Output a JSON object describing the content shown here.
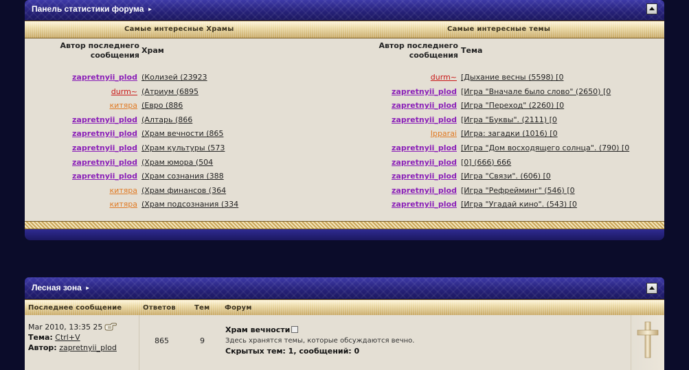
{
  "stats_panel": {
    "title": "Панель статистики форума",
    "left": {
      "heading": "Самые интересные Храмы",
      "col_author": "Автор последнего\nсообщения",
      "col_item": "Храм",
      "rows": [
        {
          "author": "zapretnyii_plod",
          "style": "purple",
          "item": "(Колизей (23923"
        },
        {
          "author": "durm~",
          "style": "red",
          "item": "(Атриум (6895"
        },
        {
          "author": "китяра",
          "style": "orange",
          "item": "(Евро (886"
        },
        {
          "author": "zapretnyii_plod",
          "style": "purple",
          "item": "(Алтарь (866"
        },
        {
          "author": "zapretnyii_plod",
          "style": "purple",
          "item": "(Храм вечности (865"
        },
        {
          "author": "zapretnyii_plod",
          "style": "purple",
          "item": "(Храм культуры (573"
        },
        {
          "author": "zapretnyii_plod",
          "style": "purple",
          "item": "(Храм юмора (504"
        },
        {
          "author": "zapretnyii_plod",
          "style": "purple",
          "item": "(Храм сознания (388"
        },
        {
          "author": "китяра",
          "style": "orange",
          "item": "(Храм финансов (364"
        },
        {
          "author": "китяра",
          "style": "orange",
          "item": "(Храм подсознания (334"
        }
      ]
    },
    "right": {
      "heading": "Самые интересные темы",
      "col_author": "Автор последнего\nсообщения",
      "col_item": "Тема",
      "rows": [
        {
          "author": "durm~",
          "style": "red",
          "item": "[Дыхание весны (5598) [0"
        },
        {
          "author": "zapretnyii_plod",
          "style": "purple",
          "item": "[Игра \"Вначале было слово\" (2650) [0"
        },
        {
          "author": "zapretnyii_plod",
          "style": "purple",
          "item": "[Игра \"Переход\" (2260) [0"
        },
        {
          "author": "zapretnyii_plod",
          "style": "purple",
          "item": "[Игра \"Буквы\". (2111) [0"
        },
        {
          "author": "Ipparai",
          "style": "orange",
          "item": "[Игра: загадки (1016) [0"
        },
        {
          "author": "zapretnyii_plod",
          "style": "purple",
          "item": "[Игра \"Дом восходящего солнца\". (790) [0"
        },
        {
          "author": "zapretnyii_plod",
          "style": "purple",
          "item": "[0] (666) 666"
        },
        {
          "author": "zapretnyii_plod",
          "style": "purple",
          "item": "[Игра \"Связи\". (606) [0"
        },
        {
          "author": "zapretnyii_plod",
          "style": "purple",
          "item": "[Игра \"Рефрейминг\" (546) [0"
        },
        {
          "author": "zapretnyii_plod",
          "style": "purple",
          "item": "[Игра \"Угадай кино\". (543) [0"
        }
      ]
    }
  },
  "forest_panel": {
    "title": "Лесная зона",
    "headers": {
      "last_post": "Последнее сообщение",
      "replies": "Ответов",
      "topics": "Тем",
      "forum": "Форум"
    },
    "row": {
      "date": "Mar 2010, 13:35 25",
      "topic_label": "Тема:",
      "topic": "Ctrl+V",
      "author_label": "Автор:",
      "author": "zapretnyii_plod",
      "replies": "865",
      "topics": "9",
      "forum_title": "Храм вечности",
      "forum_desc": "Здесь хранятся темы, которые обсуждаются вечно.",
      "hidden": "Скрытых тем: 1, сообщений: 0"
    }
  },
  "colors": {
    "background": "#0b0c2a",
    "header_blue": "#27227a",
    "gold": "#ead8a4",
    "body": "#e4dfd4",
    "author_purple": "#8a1fb8",
    "author_red": "#c81616",
    "author_orange": "#e07a24"
  }
}
